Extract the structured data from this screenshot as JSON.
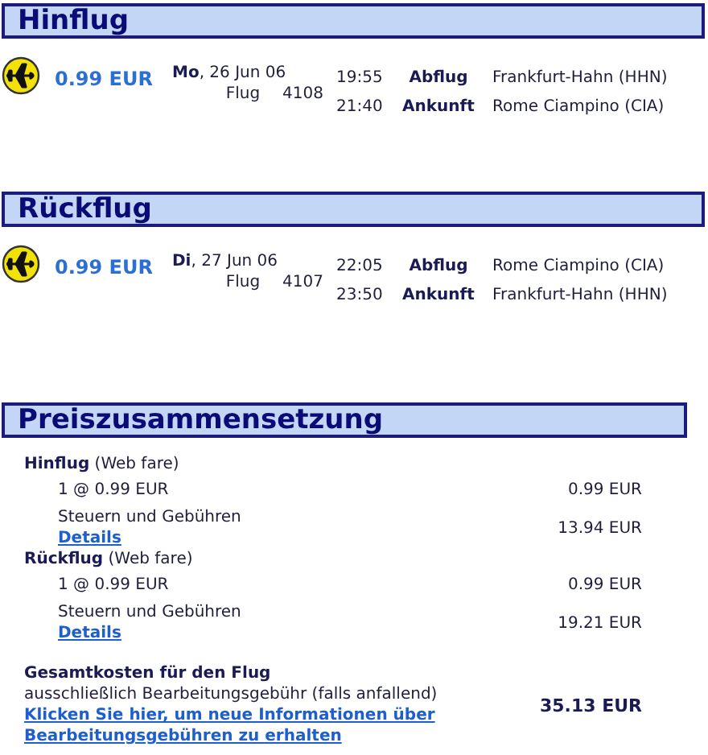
{
  "flights": [
    {
      "title": "Hinflug",
      "price": "0.99 EUR",
      "day": "Mo",
      "date": ", 26 Jun 06",
      "flight_label": "Flug",
      "flight_no": "4108",
      "legs": [
        {
          "time": "19:55",
          "label": "Abflug",
          "airport": "Frankfurt-Hahn (HHN)"
        },
        {
          "time": "21:40",
          "label": "Ankunft",
          "airport": "Rome Ciampino (CIA)"
        }
      ]
    },
    {
      "title": "Rückflug",
      "price": "0.99 EUR",
      "day": "Di",
      "date": ", 27 Jun 06",
      "flight_label": "Flug",
      "flight_no": "4107",
      "legs": [
        {
          "time": "22:05",
          "label": "Abflug",
          "airport": "Rome Ciampino (CIA)"
        },
        {
          "time": "23:50",
          "label": "Ankunft",
          "airport": "Frankfurt-Hahn (HHN)"
        }
      ]
    }
  ],
  "breakdown": {
    "title": "Preiszusammensetzung",
    "groups": [
      {
        "label": "Hinflug",
        "fare": "(Web fare)",
        "fare_line": "1 @ 0.99 EUR",
        "fare_amount": "0.99 EUR",
        "tax_label": "Steuern und Gebühren",
        "tax_amount": "13.94 EUR",
        "details": "Details"
      },
      {
        "label": "Rückflug",
        "fare": "(Web fare)",
        "fare_line": "1 @ 0.99 EUR",
        "fare_amount": "0.99 EUR",
        "tax_label": "Steuern und Gebühren",
        "tax_amount": "19.21 EUR",
        "details": "Details"
      }
    ],
    "total_label": "Gesamtkosten für den Flug",
    "total_note": "ausschließlich Bearbeitungsgebühr (falls anfallend)",
    "total": "35.13 EUR",
    "info_link": "Klicken Sie hier, um neue Informationen über Bearbeitungsgebühren zu erhalten"
  }
}
